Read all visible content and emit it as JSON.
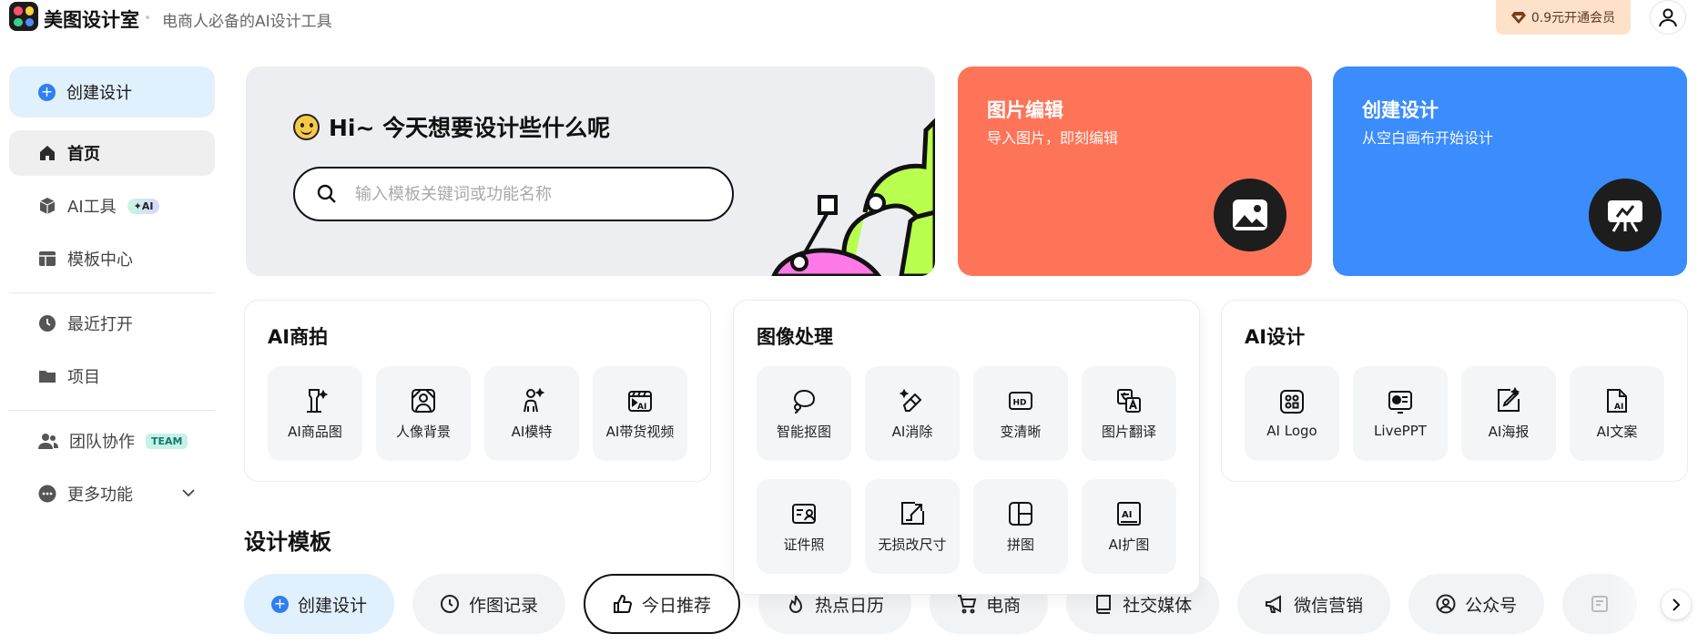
{
  "header": {
    "brand": "美图设计室",
    "slogan": "电商人必备的AI设计工具",
    "vip_label": "0.9元开通会员"
  },
  "sidebar": {
    "create_label": "创建设计",
    "items": [
      {
        "label": "首页",
        "icon": "home-icon"
      },
      {
        "label": "AI工具",
        "icon": "cube-icon",
        "badge": "✦AI"
      },
      {
        "label": "模板中心",
        "icon": "template-icon"
      },
      {
        "label": "最近打开",
        "icon": "clock-icon"
      },
      {
        "label": "项目",
        "icon": "folder-icon"
      },
      {
        "label": "团队协作",
        "icon": "team-icon",
        "badge": "TEAM"
      },
      {
        "label": "更多功能",
        "icon": "more-icon"
      }
    ]
  },
  "hero": {
    "greeting": "Hi~ 今天想要设计些什么呢",
    "search_placeholder": "输入模板关键词或功能名称"
  },
  "features": [
    {
      "title": "图片编辑",
      "subtitle": "导入图片，即刻编辑",
      "color": "#fe7458"
    },
    {
      "title": "创建设计",
      "subtitle": "从空白画布开始设计",
      "color": "#3b8cfc"
    }
  ],
  "panels": {
    "shop": {
      "title": "AI商拍",
      "tools": [
        "AI商品图",
        "人像背景",
        "AI模特",
        "AI带货视频"
      ]
    },
    "image": {
      "title": "图像处理",
      "tools": [
        "智能抠图",
        "AI消除",
        "变清晰",
        "图片翻译",
        "证件照",
        "无损改尺寸",
        "拼图",
        "AI扩图"
      ]
    },
    "design": {
      "title": "AI设计",
      "tools": [
        "AI Logo",
        "LivePPT",
        "AI海报",
        "AI文案"
      ]
    }
  },
  "templates": {
    "title": "设计模板",
    "chips": [
      "创建设计",
      "作图记录",
      "今日推荐",
      "热点日历",
      "电商",
      "社交媒体",
      "微信营销",
      "公众号"
    ]
  },
  "colors": {
    "accent_blue": "#2f7ef2",
    "edit_card": "#fe7458",
    "create_card": "#3b8cfc",
    "vip_bg": "#fde1c8"
  }
}
